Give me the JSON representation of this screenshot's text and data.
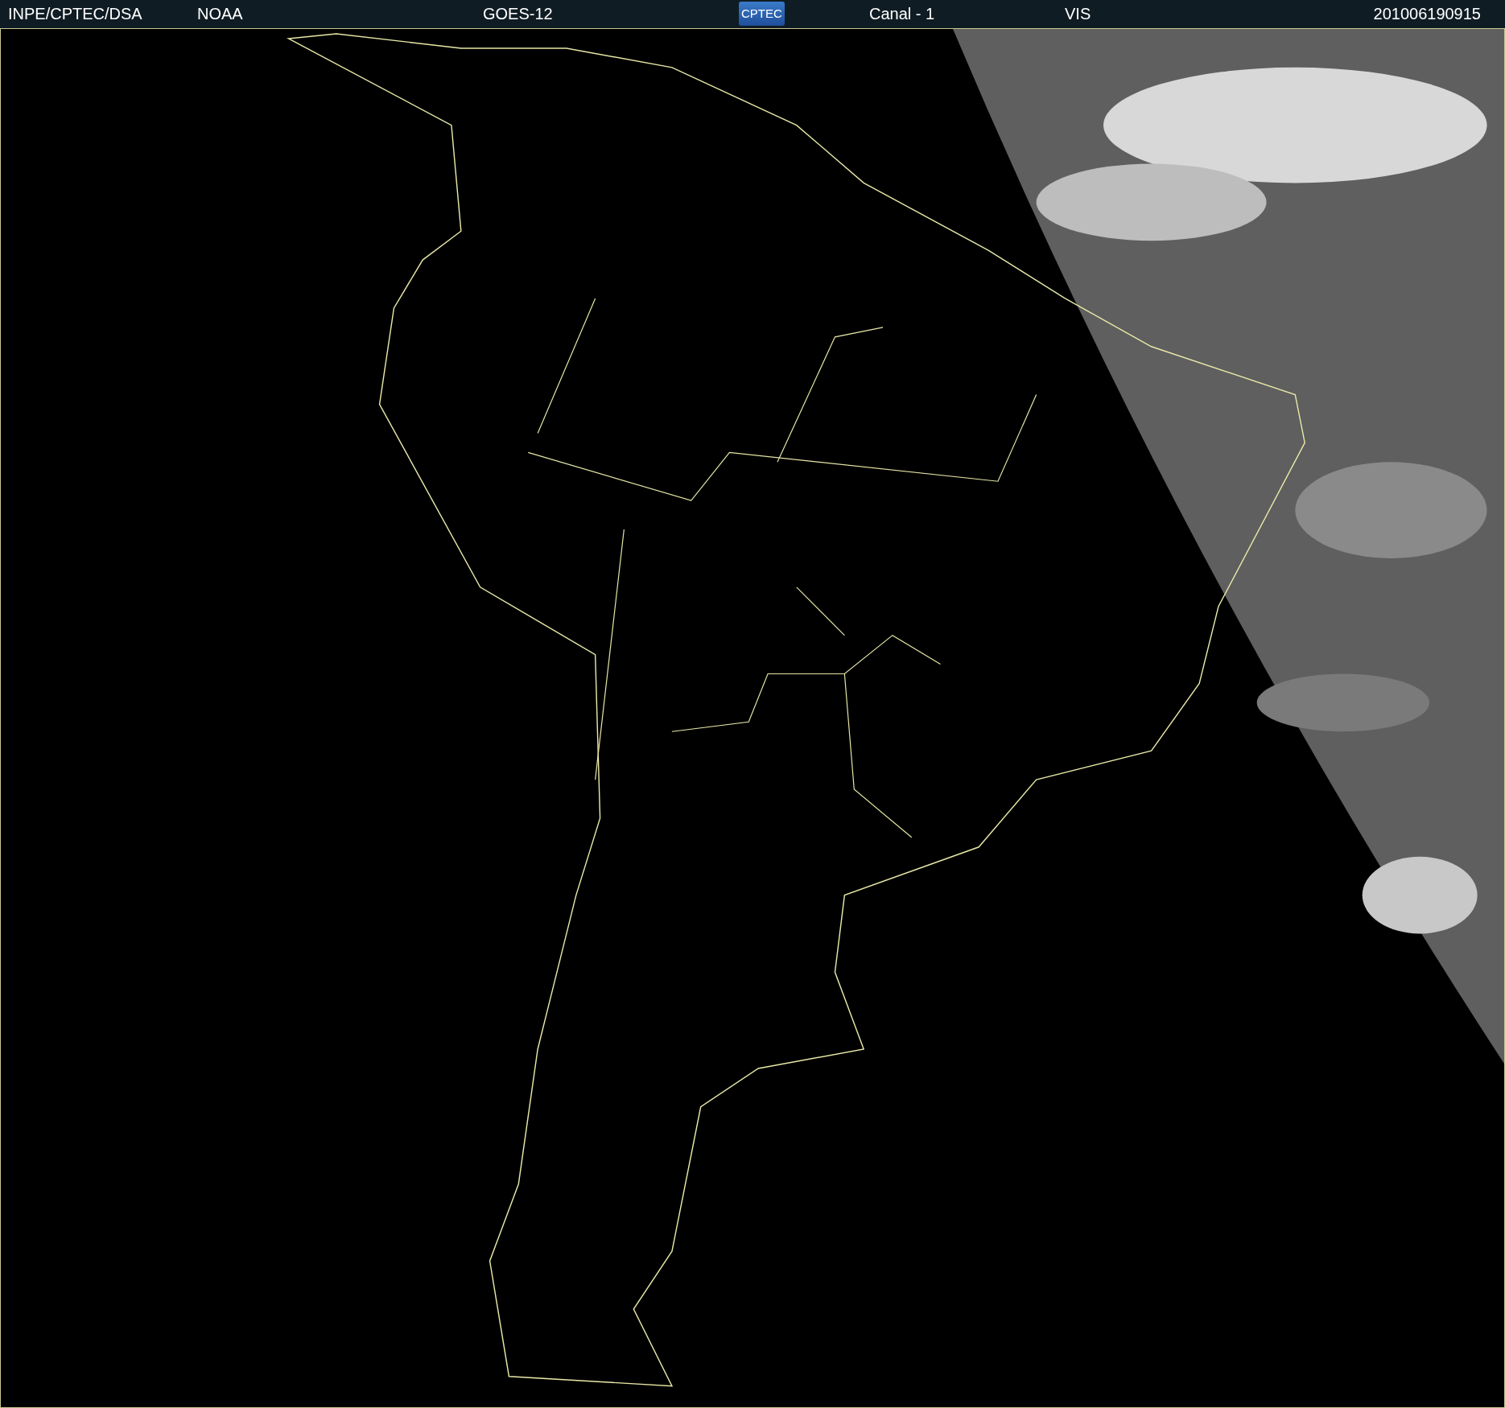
{
  "header": {
    "items": [
      {
        "kind": "text",
        "text": "INPE/CPTEC/DSA"
      },
      {
        "kind": "text",
        "text": "NOAA"
      },
      {
        "kind": "text",
        "text": "GOES-12"
      },
      {
        "kind": "logo",
        "text": "CPTEC"
      },
      {
        "kind": "text",
        "text": "Canal - 1"
      },
      {
        "kind": "text",
        "text": "VIS"
      },
      {
        "kind": "text",
        "text": "201006190915"
      }
    ]
  }
}
